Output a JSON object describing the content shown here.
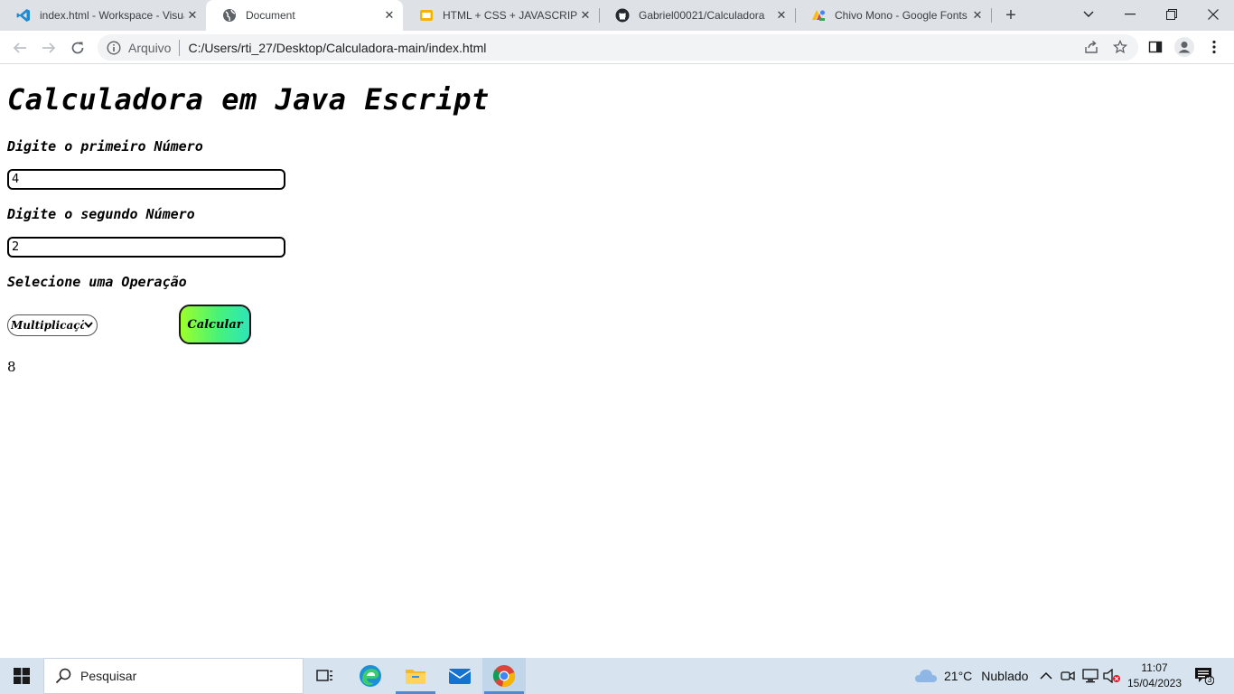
{
  "browser": {
    "tabs": [
      {
        "title": "index.html - Workspace - Visual Studio Code",
        "icon": "vscode-icon",
        "active": false
      },
      {
        "title": "Document",
        "icon": "globe-icon",
        "active": true
      },
      {
        "title": "HTML + CSS + JAVASCRIPT - Google Slides",
        "icon": "slides-icon",
        "active": false
      },
      {
        "title": "Gabriel00021/Calculadora",
        "icon": "github-icon",
        "active": false
      },
      {
        "title": "Chivo Mono - Google Fonts",
        "icon": "google-fonts-icon",
        "active": false
      }
    ],
    "address": {
      "security_label": "Arquivo",
      "url": "C:/Users/rti_27/Desktop/Calculadora-main/index.html"
    }
  },
  "page": {
    "title": "Calculadora em Java Escript",
    "first_label": "Digite o primeiro Número",
    "first_value": "4",
    "second_label": "Digite o segundo Número",
    "second_value": "2",
    "operation_label": "Selecione uma Operação",
    "operation_selected": "Multiplicação",
    "calculate_label": "Calcular",
    "result": "8"
  },
  "taskbar": {
    "search_placeholder": "Pesquisar",
    "weather_temp": "21°C",
    "weather_text": "Nublado",
    "time": "11:07",
    "date": "15/04/2023",
    "notification_count": "3"
  },
  "colors": {
    "button_gradient_start": "#9dff2b",
    "button_gradient_end": "#2ee6b8",
    "tabstrip_bg": "#dee1e6",
    "taskbar_bg": "#d7e4f0"
  }
}
